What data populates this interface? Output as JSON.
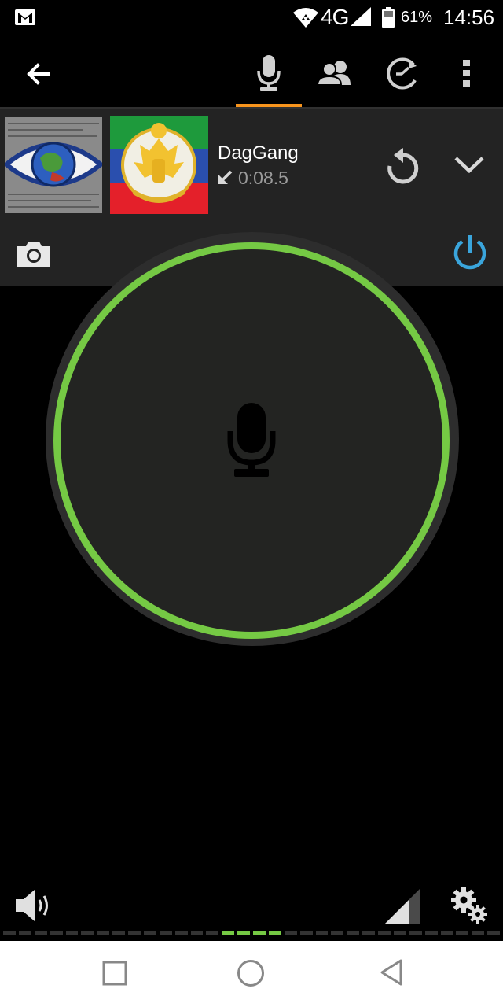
{
  "status_bar": {
    "network": "4G",
    "battery": "61%",
    "time": "14:56"
  },
  "toolbar": {
    "active_tab": "talk",
    "accent_color": "#f7941d",
    "tabs": [
      {
        "name": "talk",
        "icon": "microphone-icon"
      },
      {
        "name": "contacts",
        "icon": "people-icon"
      },
      {
        "name": "history",
        "icon": "history-icon"
      }
    ]
  },
  "contact": {
    "name": "DagGang",
    "last_message_direction": "incoming",
    "last_message_duration": "0:08.5"
  },
  "ptt": {
    "state": "ready",
    "ring_color": "#75c944"
  },
  "power": {
    "color": "#3aa5dc"
  },
  "level_meter": {
    "segments": 32,
    "active_segments": [
      14,
      15,
      16,
      17
    ]
  }
}
